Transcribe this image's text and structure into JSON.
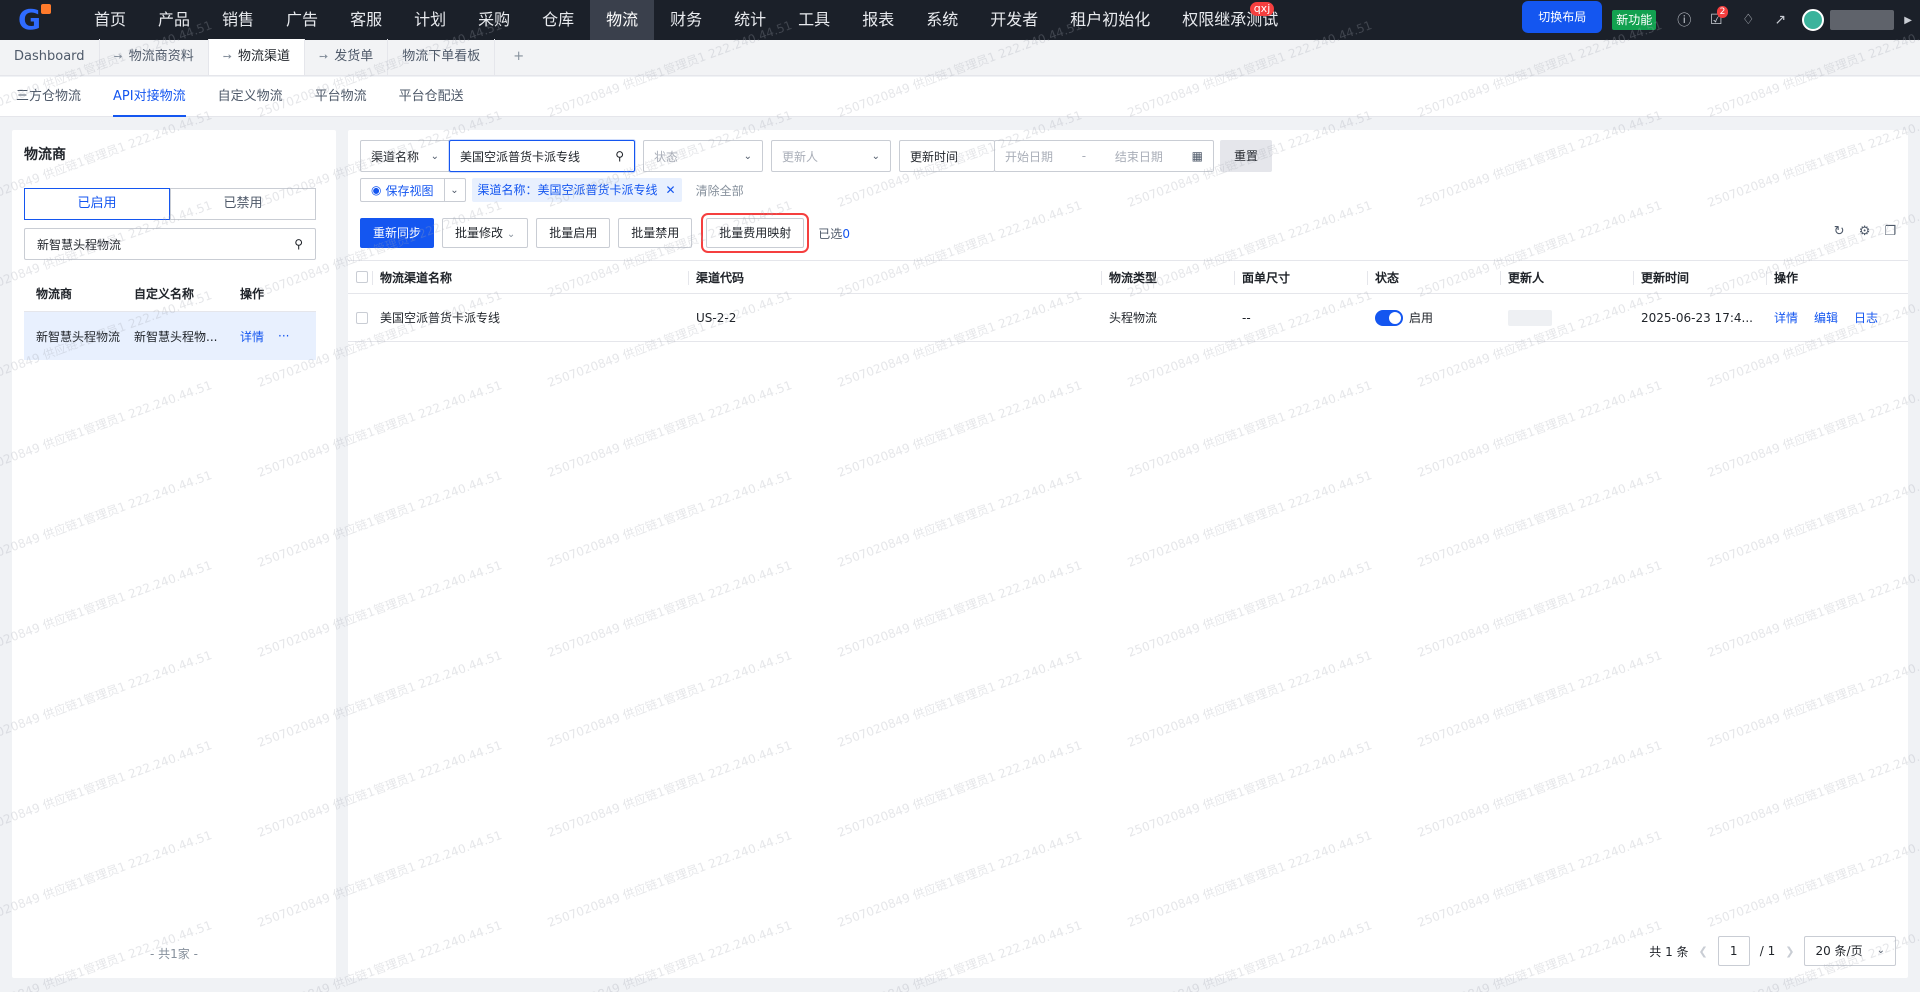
{
  "topnav": {
    "logo": "G",
    "menu": [
      {
        "label": "首页"
      },
      {
        "label": "产品"
      },
      {
        "label": "销售"
      },
      {
        "label": "广告"
      },
      {
        "label": "客服"
      },
      {
        "label": "计划"
      },
      {
        "label": "采购"
      },
      {
        "label": "仓库"
      },
      {
        "label": "物流",
        "active": true
      },
      {
        "label": "财务"
      },
      {
        "label": "统计"
      },
      {
        "label": "工具"
      },
      {
        "label": "报表"
      },
      {
        "label": "系统"
      },
      {
        "label": "开发者"
      },
      {
        "label": "租户初始化"
      },
      {
        "label": "权限继承测试",
        "badge": "qxj"
      }
    ],
    "switch_layout": "切换布局",
    "new_feature": "新功能",
    "notification_badge": "2"
  },
  "tabs": [
    {
      "label": "Dashboard",
      "pinned": false
    },
    {
      "label": "物流商资料",
      "pinned": true
    },
    {
      "label": "物流渠道",
      "pinned": true,
      "active": true
    },
    {
      "label": "发货单",
      "pinned": true
    },
    {
      "label": "物流下单看板",
      "pinned": false
    }
  ],
  "add_tab": "+",
  "subtabs": [
    {
      "label": "三方仓物流"
    },
    {
      "label": "API对接物流",
      "active": true
    },
    {
      "label": "自定义物流"
    },
    {
      "label": "平台物流"
    },
    {
      "label": "平台仓配送"
    }
  ],
  "left": {
    "title": "物流商",
    "seg_enabled": "已启用",
    "seg_disabled": "已禁用",
    "search_value": "新智慧头程物流",
    "headers": {
      "provider": "物流商",
      "custom_name": "自定义名称",
      "op": "操作"
    },
    "row": {
      "provider": "新智慧头程物流",
      "custom_name": "新智慧头程物...",
      "detail": "详情",
      "more": "···"
    },
    "footer": "- 共1家 -"
  },
  "filters": {
    "field_select": "渠道名称",
    "search_value": "美国空派普货卡派专线",
    "status_placeholder": "状态",
    "updater_placeholder": "更新人",
    "time_select": "更新时间",
    "start_placeholder": "开始日期",
    "range_sep": "-",
    "end_placeholder": "结束日期",
    "reset": "重置"
  },
  "tagrow": {
    "save_view": "保存视图",
    "filter_tag": "渠道名称：美国空派普货卡派专线",
    "clear_all": "清除全部"
  },
  "actions": {
    "resync": "重新同步",
    "batch_edit": "批量修改",
    "batch_enable": "批量启用",
    "batch_disable": "批量禁用",
    "batch_fee_map": "批量费用映射",
    "selected_label": "已选",
    "selected_count": "0"
  },
  "table": {
    "headers": {
      "name": "物流渠道名称",
      "code": "渠道代码",
      "type": "物流类型",
      "size": "面单尺寸",
      "status": "状态",
      "updater": "更新人",
      "updated": "更新时间",
      "op": "操作"
    },
    "rows": [
      {
        "name": "美国空派普货卡派专线",
        "code": "US-2-2",
        "type": "头程物流",
        "size": "--",
        "status": "启用",
        "updated": "2025-06-23 17:4...",
        "op_detail": "详情",
        "op_edit": "编辑",
        "op_log": "日志"
      }
    ]
  },
  "pager": {
    "total": "共 1 条",
    "current": "1",
    "sep": "/ 1",
    "page_size": "20 条/页"
  },
  "watermark_text": "2507020849 供应链1管理员1 222.240.44.51"
}
